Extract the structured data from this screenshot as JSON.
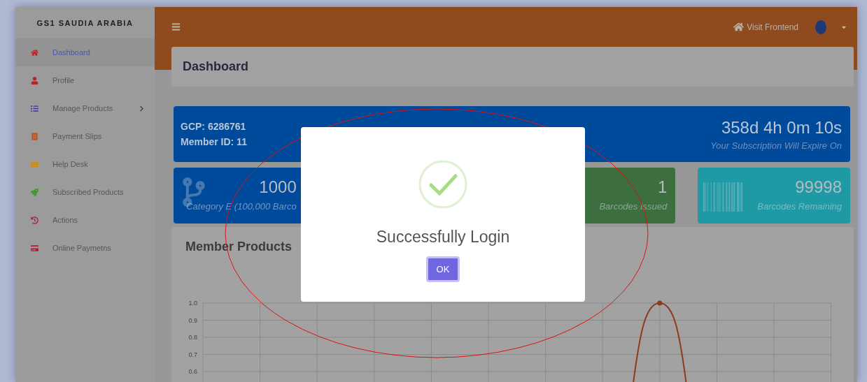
{
  "sidebar": {
    "brand": "GS1 SAUDIA ARABIA",
    "items": [
      {
        "label": "Dashboard",
        "selected": true
      },
      {
        "label": "Profile",
        "selected": false
      },
      {
        "label": "Manage Products",
        "selected": false,
        "expandable": true
      },
      {
        "label": "Payment Slips",
        "selected": false
      },
      {
        "label": "Help Desk",
        "selected": false
      },
      {
        "label": "Subscribed Products",
        "selected": false
      },
      {
        "label": "Actions",
        "selected": false
      },
      {
        "label": "Online Paymetns",
        "selected": false
      }
    ]
  },
  "topbar": {
    "link": "Visit Frontend"
  },
  "page_title": "Dashboard",
  "info_card": {
    "gcp": "GCP: 6286761",
    "member_id": "Member ID: 11",
    "countdown": "358d 4h 0m 10s",
    "caption": "Your Subscription Will Expire On"
  },
  "stats": [
    {
      "kind": "branch",
      "value": "1000",
      "label": "Category E (100,000 Barco",
      "color": "#004a9c"
    },
    {
      "kind": "plain",
      "value": "1",
      "label": "Barcodes Issued",
      "color": "#3d6e40"
    },
    {
      "kind": "barcode",
      "value": "99998",
      "label": "Barcodes Remaining",
      "color": "#1f9aa4"
    }
  ],
  "products": {
    "title": "Member Products",
    "y_axis_labels": [
      "1.0",
      "0.9",
      "0.8",
      "0.7",
      "0.6"
    ]
  },
  "modal": {
    "title": "Successfully Login",
    "button": "OK"
  }
}
